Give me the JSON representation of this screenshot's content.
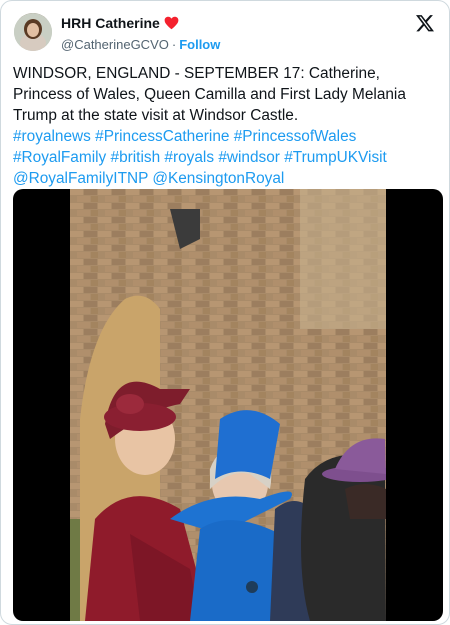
{
  "author": {
    "display_name": "HRH Catherine",
    "handle": "@CatherineGCVO",
    "separator": "·",
    "follow_label": "Follow",
    "avatar_icon": "profile-avatar",
    "verified_emoji": "heart-icon"
  },
  "platform_logo": "x-logo-icon",
  "tweet": {
    "lines": [
      "WINDSOR, ENGLAND - SEPTEMBER 17: Catherine,",
      "Princess of Wales, Queen Camilla and First Lady Melania",
      "Trump at the state visit at Windsor Castle."
    ],
    "hashtags_line1": [
      "#royalnews",
      "#PrincessCatherine",
      "#PrincessofWales"
    ],
    "hashtags_line2": [
      "#RoyalFamily",
      "#british",
      "#royals",
      "#windsor",
      "#TrumpUKVisit"
    ],
    "mentions": [
      "@RoyalFamilyITNP",
      "@KensingtonRoyal"
    ]
  },
  "media": {
    "type": "video-still"
  },
  "colors": {
    "link": "#1d9bf0",
    "secondary_text": "#536471",
    "heart": "#f4212e"
  }
}
